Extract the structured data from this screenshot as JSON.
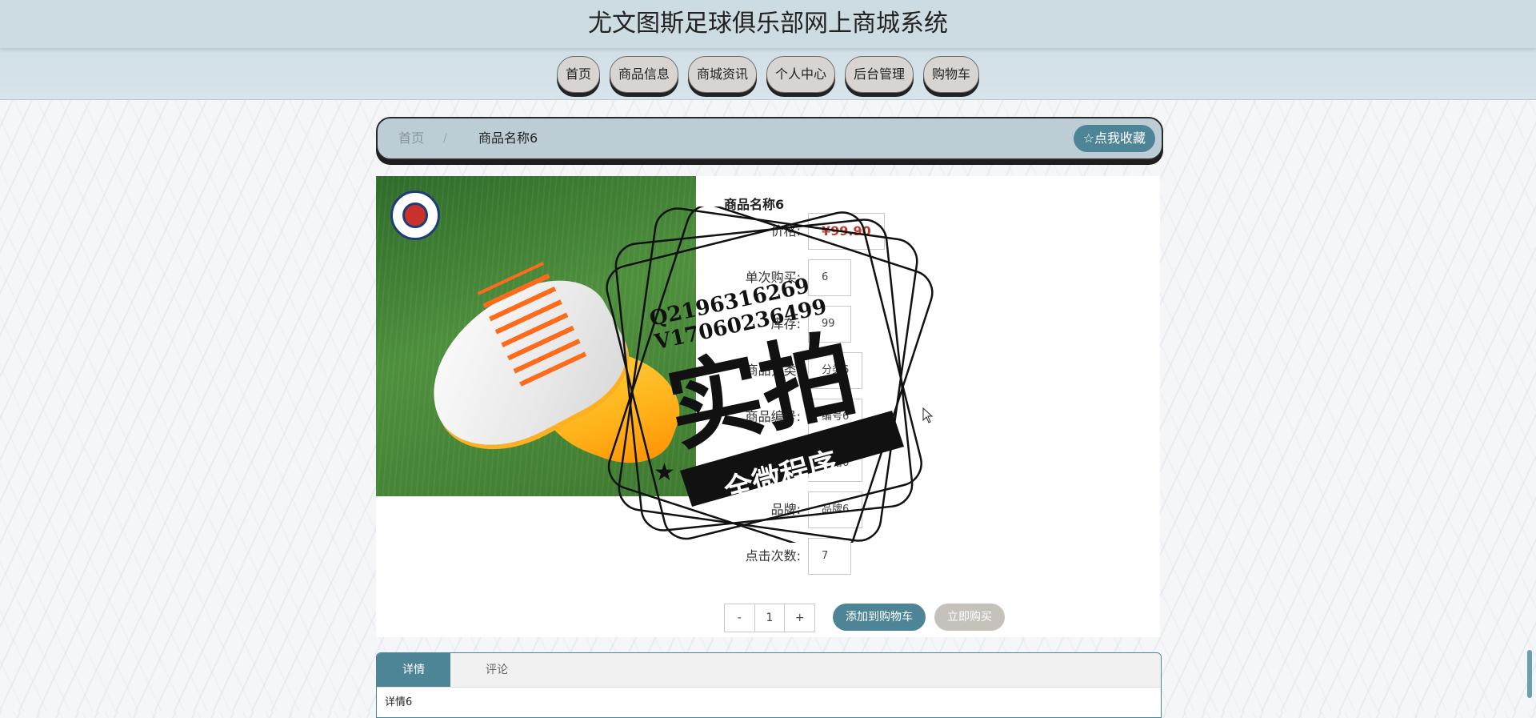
{
  "header": {
    "title": "尤文图斯足球俱乐部网上商城系统"
  },
  "nav": [
    "首页",
    "商品信息",
    "商城资讯",
    "个人中心",
    "后台管理",
    "购物车"
  ],
  "breadcrumb": {
    "home": "首页",
    "separator": "/",
    "current": "商品名称6",
    "favorite": "☆点我收藏"
  },
  "product": {
    "name": "商品名称6",
    "fields": [
      {
        "label": "价格:",
        "value": "¥99.90"
      },
      {
        "label": "单次购买:",
        "value": "6"
      },
      {
        "label": "库存:",
        "value": "99"
      },
      {
        "label": "商品分类:",
        "value": "分类6"
      },
      {
        "label": "商品编号:",
        "value": "编号6"
      },
      {
        "label": "规格:",
        "value": "规格6"
      },
      {
        "label": "品牌:",
        "value": "品牌6"
      },
      {
        "label": "点击次数:",
        "value": "7"
      }
    ],
    "quantity": {
      "minus": "-",
      "value": "1",
      "plus": "+"
    },
    "add_to_cart": "添加到购物车",
    "buy_now": "立即购买"
  },
  "tabs": {
    "detail": "详情",
    "comments": "评论",
    "detail_text": "详情6"
  },
  "watermark": {
    "line1": "Q2196316269",
    "line2": "V17060236499",
    "big": "实拍",
    "banner": "全微程序"
  },
  "colors": {
    "accent": "#4e8596",
    "price": "#c0392b",
    "header_bg": "#cddbe3"
  }
}
